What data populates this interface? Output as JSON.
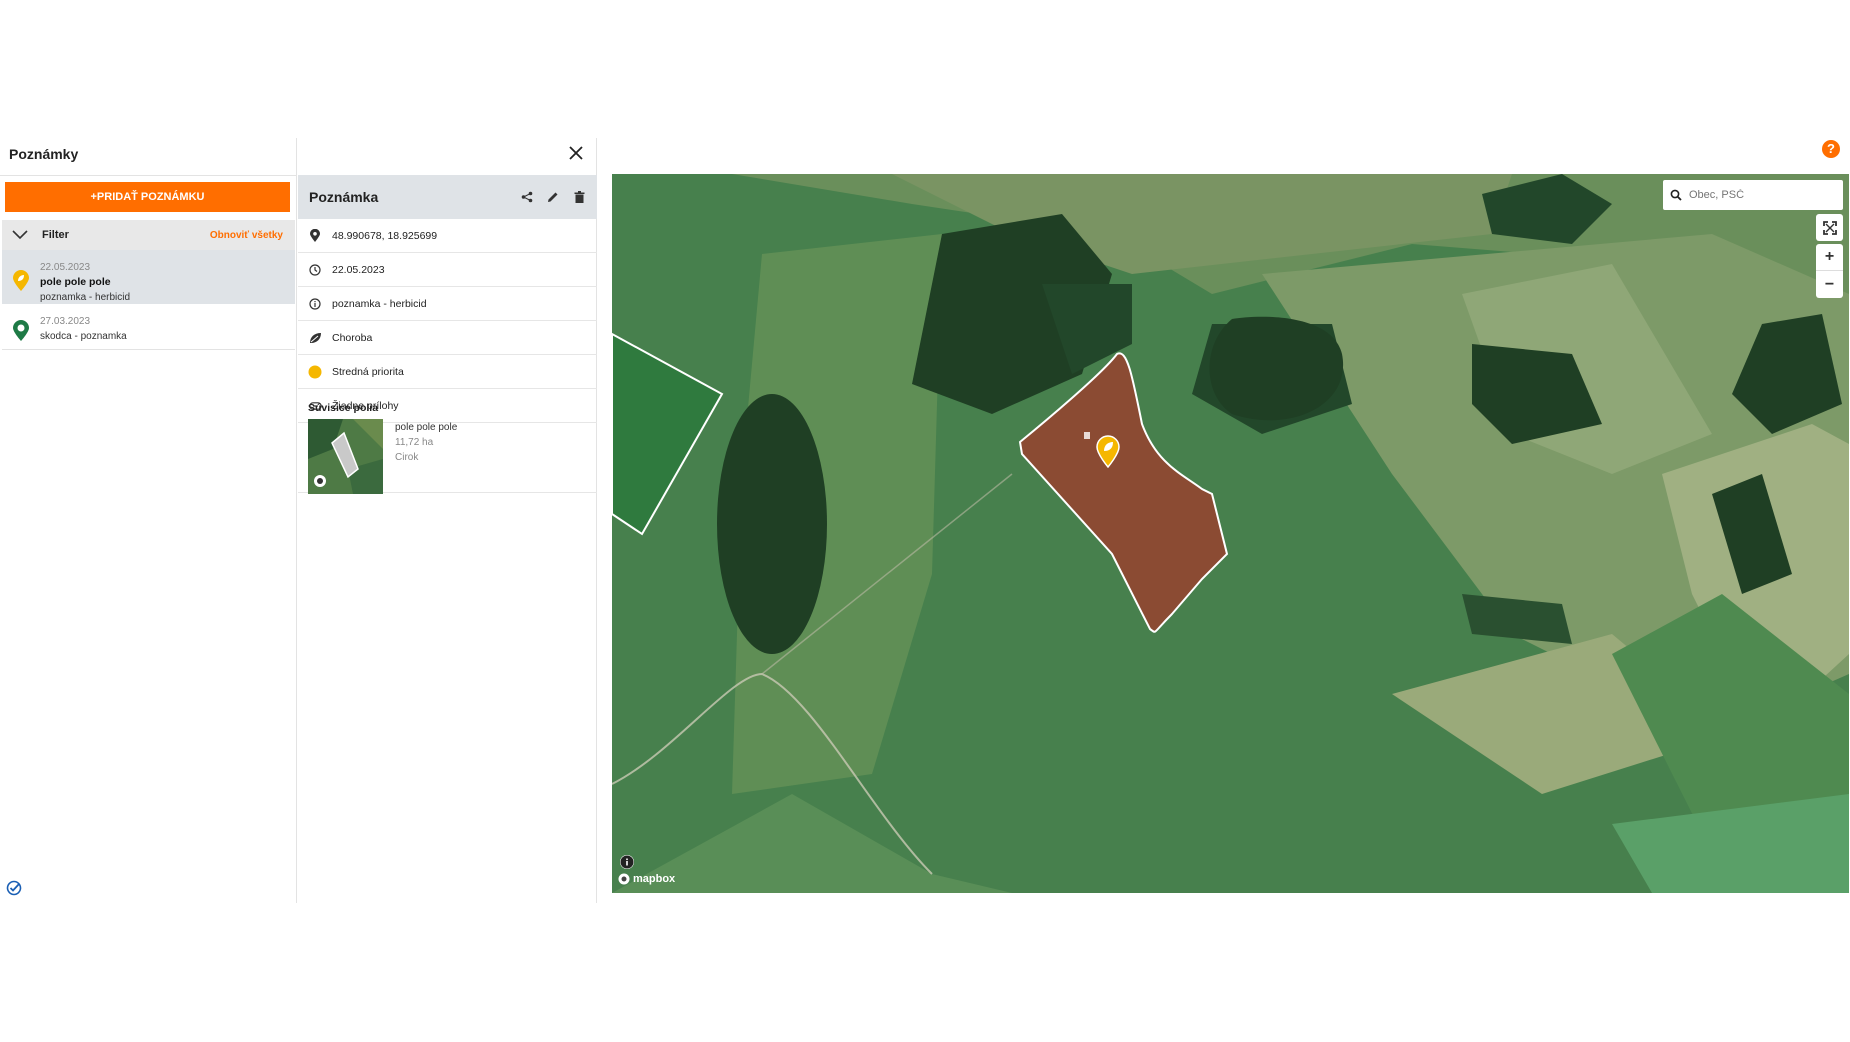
{
  "left": {
    "title": "Poznámky",
    "add_button": "+PRIDAŤ POZNÁMKU",
    "filter_label": "Filter",
    "filter_reset": "Obnoviť všetky",
    "notes": [
      {
        "date": "22.05.2023",
        "title": "pole pole pole",
        "subtitle": "poznamka - herbicid",
        "pin_color": "#f5b700",
        "active": true
      },
      {
        "date": "27.03.2023",
        "title": "",
        "subtitle": "skodca - poznamka",
        "pin_color": "#1e7a46",
        "active": false
      }
    ]
  },
  "detail": {
    "title": "Poznámka",
    "rows": [
      {
        "icon": "location-pin-icon",
        "text": "48.990678, 18.925699"
      },
      {
        "icon": "clock-icon",
        "text": "22.05.2023"
      },
      {
        "icon": "info-icon",
        "text": "poznamka - herbicid"
      },
      {
        "icon": "leaf-disease-icon",
        "text": "Choroba"
      },
      {
        "icon": "priority-dot-icon",
        "text": "Stredná priorita"
      },
      {
        "icon": "attachment-icon",
        "text": "Žiadne prílohy"
      }
    ],
    "related_title": "Súvisice polia",
    "related_field": {
      "name": "pole pole pole",
      "area": "11,72 ha",
      "crop": "Cirok"
    }
  },
  "map": {
    "search_placeholder": "Obec, PSČ",
    "zoom_in": "+",
    "zoom_out": "−",
    "attribution": "mapbox"
  },
  "colors": {
    "accent": "#ff6e00",
    "priority_medium": "#f5b700",
    "field_fill": "#8b4b33"
  },
  "help_label": "?"
}
